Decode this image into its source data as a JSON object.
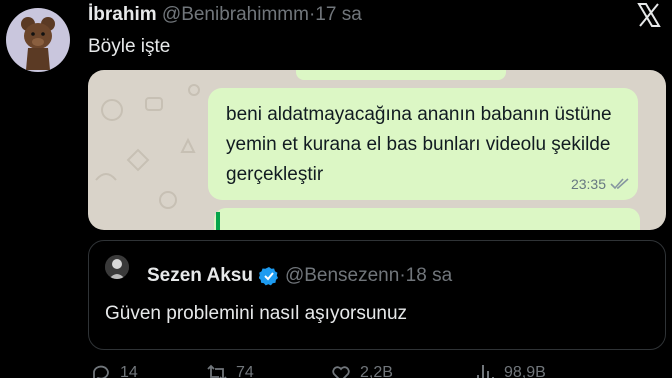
{
  "tweet": {
    "author_name": "İbrahim",
    "author_handle": "@Benibrahimmm",
    "separator": "·",
    "time": "17 sa",
    "text": "Böyle işte"
  },
  "media": {
    "message": "beni aldatmayacağına ananın babanın üstüne yemin et kurana el bas bunları videolu şekilde gerçekleştir",
    "timestamp": "23:35"
  },
  "quote": {
    "author_name": "Sezen Aksu",
    "author_handle": "@Bensezenn",
    "separator": "·",
    "time": "18 sa",
    "text": "Güven problemini nasıl aşıyorsunuz"
  },
  "actions": {
    "replies": "14",
    "reposts": "74",
    "likes": "2,2B",
    "views": "98,9B"
  },
  "icons": [
    "bear-avatar",
    "close-icon",
    "verified-icon",
    "reply-icon",
    "repost-icon",
    "like-icon",
    "views-icon"
  ],
  "colors": {
    "background": "#000000",
    "text": "#e7e9ea",
    "muted": "#71767b",
    "verified": "#1d9bf0",
    "bubble": "#dcf7c5",
    "chat-bg": "#d9d3c9"
  }
}
